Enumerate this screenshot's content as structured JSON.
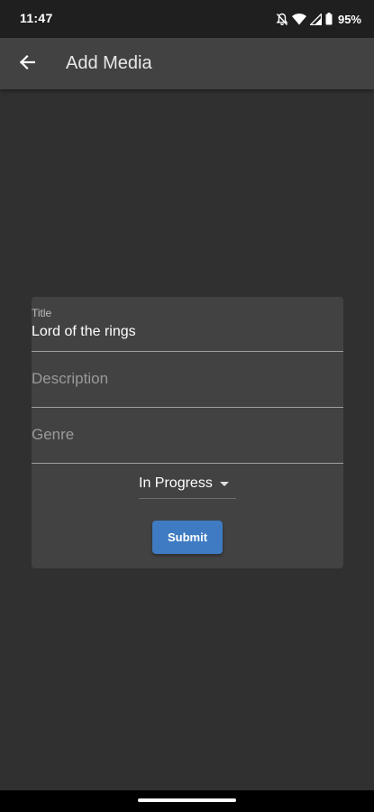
{
  "status_bar": {
    "time": "11:47",
    "battery": "95%",
    "icons": [
      "notifications-off-icon",
      "wifi-icon",
      "signal-icon",
      "battery-icon"
    ]
  },
  "app_bar": {
    "title": "Add Media",
    "back_icon": "arrow-back-icon"
  },
  "form": {
    "title_label": "Title",
    "title_value": "Lord of the rings",
    "description_placeholder": "Description",
    "genre_placeholder": "Genre",
    "status_selected": "In Progress",
    "submit_label": "Submit"
  },
  "colors": {
    "background": "#303030",
    "app_bar": "#424242",
    "card": "#424242",
    "accent": "#3f7bc2",
    "status_bar": "#1f1f1f"
  }
}
